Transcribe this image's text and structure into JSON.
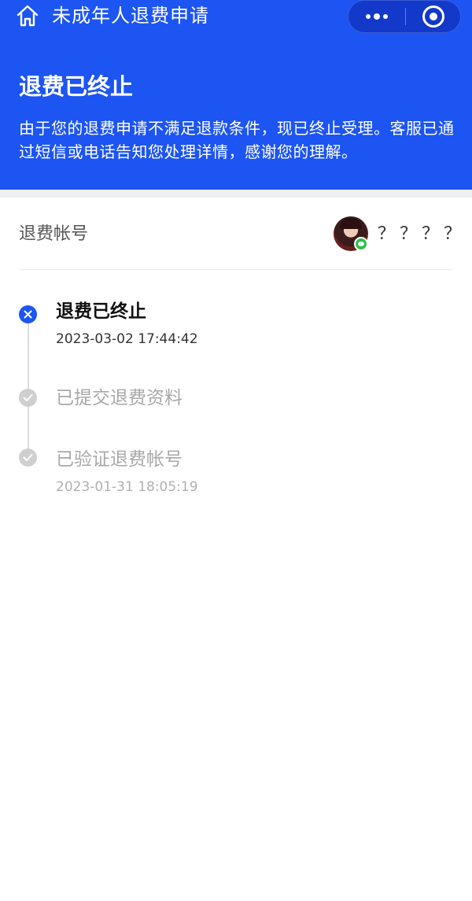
{
  "nav": {
    "title": "未成年人退费申请",
    "icons": {
      "home": "home-icon",
      "more": "more-dots-icon",
      "close": "close-target-icon"
    }
  },
  "status": {
    "title": "退费已终止",
    "description": "由于您的退费申请不满足退款条件，现已终止受理。客服已通过短信或电话告知您处理详情，感谢您的理解。"
  },
  "account": {
    "label": "退费帐号",
    "name": "？？？？",
    "badge": "wechat-icon"
  },
  "timeline": [
    {
      "title": "退费已终止",
      "time": "2023-03-02 17:44:42",
      "state": "active",
      "icon": "x-icon"
    },
    {
      "title": "已提交退费资料",
      "time": "",
      "state": "done",
      "icon": "check-icon"
    },
    {
      "title": "已验证退费帐号",
      "time": "2023-01-31 18:05:19",
      "state": "done",
      "icon": "check-icon"
    }
  ],
  "colors": {
    "brand": "#1d55f2",
    "muted": "#a8a8a8",
    "divider": "#ececec"
  }
}
